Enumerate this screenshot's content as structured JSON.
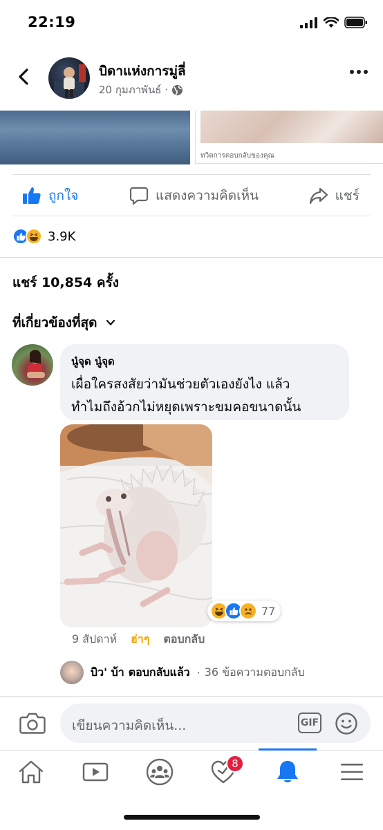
{
  "status_bar": {
    "time": "22:19"
  },
  "header": {
    "page_name": "บิดาแห่งการมู่ลี่",
    "date": "20 กุมภาพันธ์ ·"
  },
  "shared_preview": {
    "caption": "ทวิตการตอบกลับของคุณ"
  },
  "actions": {
    "like_label": "ถูกใจ",
    "comment_label": "แสดงความคิดเห็น",
    "share_label": "แชร์"
  },
  "reactions": {
    "count": "3.9K"
  },
  "shares": {
    "text": "แชร์ 10,854 ครั้ง"
  },
  "comments_filter": {
    "label": "ที่เกี่ยวข้องที่สุด"
  },
  "comment": {
    "author": "นู๋จุด นู๋จุด",
    "text_line1": "เผื่อใครสงสัยว่ามันช่วยตัวเองยังไง แล้ว",
    "text_line2": "ทำไมถึงอ้วกไม่หยุดเพราะขมคอขนาดนั้น",
    "reaction_count": "77",
    "time": "9 สัปดาห์",
    "haha_label": "ฮ่าๆ",
    "reply_label": "ตอบกลับ"
  },
  "replies": {
    "replier": "บิว' บ้า",
    "replied_label": "ตอบกลับแล้ว",
    "separator": "·",
    "count_text": "36 ข้อความตอบกลับ"
  },
  "composer": {
    "placeholder": "เขียนความคิดเห็น...",
    "gif_label": "GIF"
  },
  "tabbar": {
    "notification_badge": "8",
    "items": [
      "home-icon",
      "watch-icon",
      "groups-icon",
      "dating-icon",
      "notifications-icon",
      "menu-icon"
    ],
    "active": "notifications-icon"
  },
  "colors": {
    "accent": "#1877f2",
    "haha": "#f0a400",
    "badge": "#e41e3f",
    "muted": "#65676b"
  }
}
